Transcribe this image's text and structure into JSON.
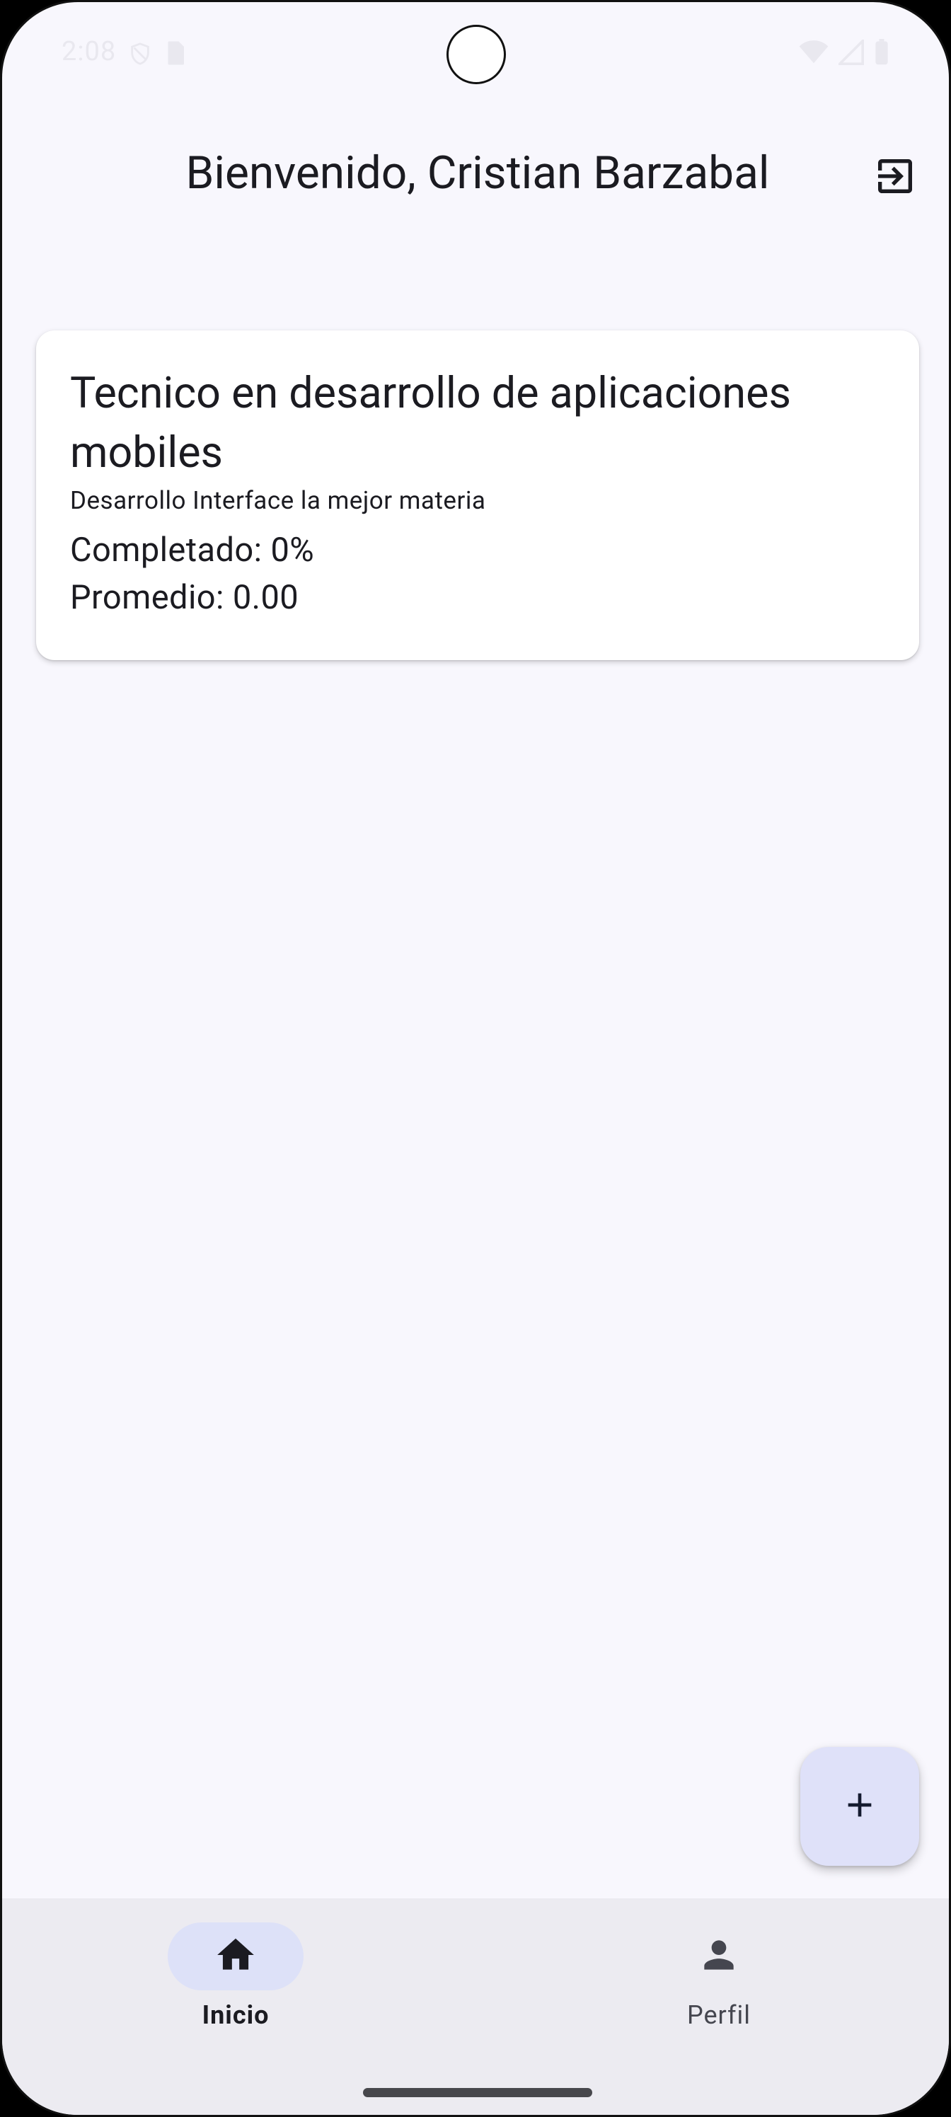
{
  "status_bar": {
    "time": "2:08"
  },
  "header": {
    "title": "Bienvenido, Cristian Barzabal",
    "logout_icon": "logout-icon"
  },
  "courses": [
    {
      "title": "Tecnico en desarrollo de aplicaciones mobiles",
      "subtitle": "Desarrollo Interface la mejor materia",
      "completed": "Completado: 0%",
      "average": "Promedio: 0.00"
    }
  ],
  "fab": {
    "icon": "plus-icon"
  },
  "bottom_nav": {
    "items": [
      {
        "label": "Inicio",
        "icon": "home-icon",
        "active": true
      },
      {
        "label": "Perfil",
        "icon": "person-icon",
        "active": false
      }
    ]
  },
  "colors": {
    "background": "#f8f7fd",
    "card": "#ffffff",
    "fab": "#dfe1f9",
    "nav_background": "#ecebf1",
    "nav_active_pill": "#dde1f8",
    "text": "#1b1b21"
  }
}
